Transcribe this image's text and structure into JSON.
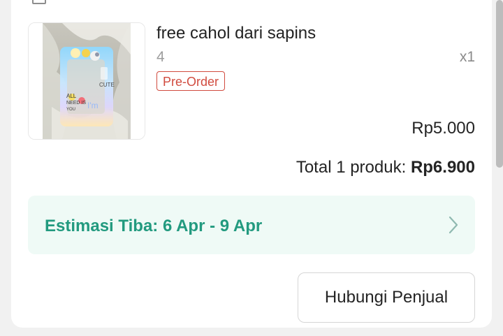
{
  "order_item": {
    "product_name": "free cahol dari sapins",
    "variant": "4",
    "quantity": "x1",
    "badge": "Pre-Order",
    "price": "Rp5.000"
  },
  "summary": {
    "total_label": "Total 1 produk: ",
    "total_amount": "Rp6.900"
  },
  "delivery": {
    "estimate": "Estimasi Tiba: 6 Apr - 9 Apr"
  },
  "actions": {
    "contact_seller_label": "Hubungi Penjual"
  },
  "colors": {
    "accent": "#229a7f",
    "estimate_background": "#effaf6",
    "badge": "#d14b3f"
  },
  "icons": {
    "chevron": "chevron-right-icon",
    "top": "checkbox-icon"
  }
}
